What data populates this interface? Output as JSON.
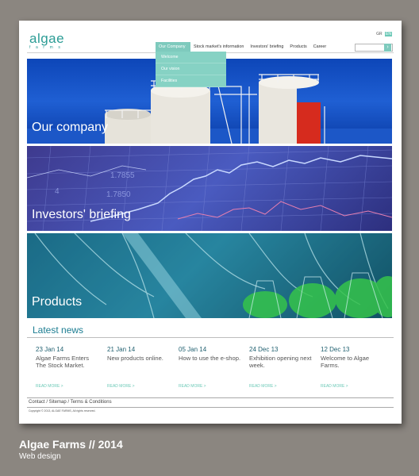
{
  "header": {
    "logo_main": "algae",
    "logo_sub": "farms",
    "lang_gr": "GR",
    "lang_en": "EN"
  },
  "nav": {
    "items": [
      {
        "label": "Our Company"
      },
      {
        "label": "Stock market's information"
      },
      {
        "label": "Investors' briefing"
      },
      {
        "label": "Products"
      },
      {
        "label": "Career"
      }
    ],
    "search_placeholder": "",
    "search_icon": "search-icon"
  },
  "dropdown": {
    "items": [
      {
        "label": "Welcome"
      },
      {
        "label": "Our vision"
      },
      {
        "label": "Facilities"
      }
    ]
  },
  "banners": [
    {
      "label": "Our company"
    },
    {
      "label": "Investors' briefing"
    },
    {
      "label": "Products"
    }
  ],
  "news": {
    "title": "Latest news",
    "items": [
      {
        "date": "23 Jan 14",
        "text": "Algae Farms Enters The Stock Market.",
        "more": "READ MORE >"
      },
      {
        "date": "21 Jan 14",
        "text": "New products online.",
        "more": "READ MORE >"
      },
      {
        "date": "05 Jan 14",
        "text": "How to use the e-shop.",
        "more": "READ MORE >"
      },
      {
        "date": "24 Dec 13",
        "text": "Exhibition opening next week.",
        "more": "READ MORE >"
      },
      {
        "date": "12 Dec 13",
        "text": "Welcome to Algae Farms.",
        "more": "READ MORE >"
      }
    ]
  },
  "footer": {
    "links": "Contact / Sitemap / Terms & Conditions",
    "copyright": "Copyright © 2013, ALGAE FARMS, All rights reserved."
  },
  "caption": {
    "title": "Algae Farms // 2014",
    "subtitle": "Web design"
  },
  "colors": {
    "accent": "#7ecabd",
    "brand": "#2b9c95",
    "news_title": "#1c7d92"
  }
}
